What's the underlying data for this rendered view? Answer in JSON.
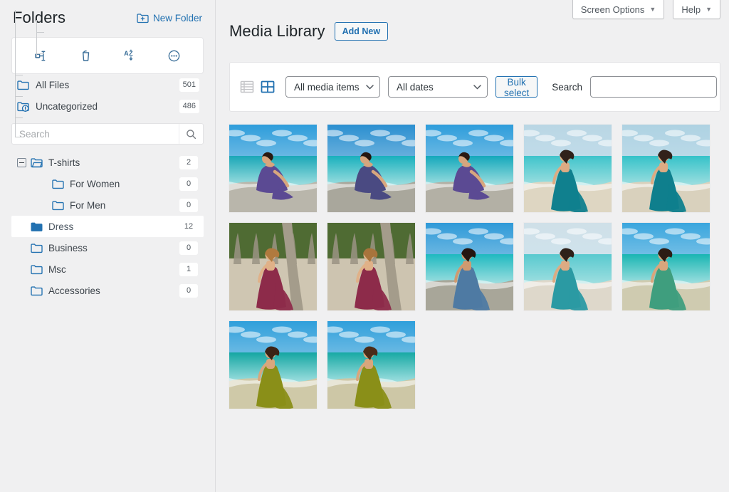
{
  "sidebar": {
    "title": "Folders",
    "new_folder_label": "New Folder",
    "toolbar": [
      {
        "name": "organize-folders-icon",
        "title": "Organize"
      },
      {
        "name": "trash-icon",
        "title": "Trash"
      },
      {
        "name": "sort-az-icon",
        "title": "Sort A-Z"
      },
      {
        "name": "more-options-icon",
        "title": "More"
      }
    ],
    "roots": [
      {
        "label": "All Files",
        "count": "501",
        "icon": "folder-outline-icon"
      },
      {
        "label": "Uncategorized",
        "count": "486",
        "icon": "folder-uncategorized-icon"
      }
    ],
    "search": {
      "placeholder": "Search",
      "value": ""
    },
    "tree": [
      {
        "label": "T-shirts",
        "count": "2",
        "depth": 0,
        "expandable": true,
        "expanded": true,
        "selected": false,
        "icon": "folder-open-icon"
      },
      {
        "label": "For Women",
        "count": "0",
        "depth": 1,
        "expandable": false,
        "expanded": false,
        "selected": false,
        "icon": "folder-outline-icon"
      },
      {
        "label": "For Men",
        "count": "0",
        "depth": 1,
        "expandable": false,
        "expanded": false,
        "selected": false,
        "icon": "folder-outline-icon"
      },
      {
        "label": "Dress",
        "count": "12",
        "depth": 0,
        "expandable": false,
        "expanded": false,
        "selected": true,
        "icon": "folder-filled-icon"
      },
      {
        "label": "Business",
        "count": "0",
        "depth": 0,
        "expandable": false,
        "expanded": false,
        "selected": false,
        "icon": "folder-outline-icon"
      },
      {
        "label": "Msc",
        "count": "1",
        "depth": 0,
        "expandable": false,
        "expanded": false,
        "selected": false,
        "icon": "folder-outline-icon"
      },
      {
        "label": "Accessories",
        "count": "0",
        "depth": 0,
        "expandable": false,
        "expanded": false,
        "selected": false,
        "icon": "folder-outline-icon"
      }
    ]
  },
  "topbar": {
    "screen_options_label": "Screen Options",
    "help_label": "Help",
    "caret": "▼"
  },
  "main": {
    "page_title": "Media Library",
    "add_new_label": "Add New",
    "filters": {
      "list_view_icon": "list-view-icon",
      "grid_view_icon": "grid-view-icon",
      "media_type_value": "All media items",
      "dates_value": "All dates",
      "bulk_select_label": "Bulk select",
      "search_label": "Search",
      "search_value": "",
      "search_placeholder": ""
    },
    "items": [
      {
        "alt": "Woman in purple dress sitting on rocks by the sea",
        "theme": "purple-rocks"
      },
      {
        "alt": "Woman in purple dress on rocks with crashing wave",
        "theme": "purple-wave"
      },
      {
        "alt": "Woman in purple dress with sunglasses on rocky shore",
        "theme": "purple-shore"
      },
      {
        "alt": "Woman in teal gown on sandy dune, back view",
        "theme": "teal-dune"
      },
      {
        "alt": "Woman in teal halter gown walking on dune",
        "theme": "teal-gown"
      },
      {
        "alt": "Woman in burgundy dress by palm trees on beach",
        "theme": "burgundy-palm"
      },
      {
        "alt": "Woman in burgundy dress leaning on palm tree",
        "theme": "burgundy-palm2"
      },
      {
        "alt": "Woman in blue dress on rocky shoreline by turquoise sea",
        "theme": "blue-shore"
      },
      {
        "alt": "Woman in light teal dress standing on beach",
        "theme": "lightteal-beach"
      },
      {
        "alt": "Woman in green gown on beach with arms raised",
        "theme": "green-beach"
      },
      {
        "alt": "Woman in olive gown on the beach looking out to sea",
        "theme": "olive-sea"
      },
      {
        "alt": "Woman in olive gown with flowing skirt on the shore",
        "theme": "olive-shore"
      }
    ]
  },
  "colors": {
    "accent": "#2271b1",
    "folder_blue": "#2271b1",
    "page_bg": "#f0f0f1",
    "card_bg": "#ffffff",
    "border": "#dcdcde",
    "text": "#3c434a"
  }
}
